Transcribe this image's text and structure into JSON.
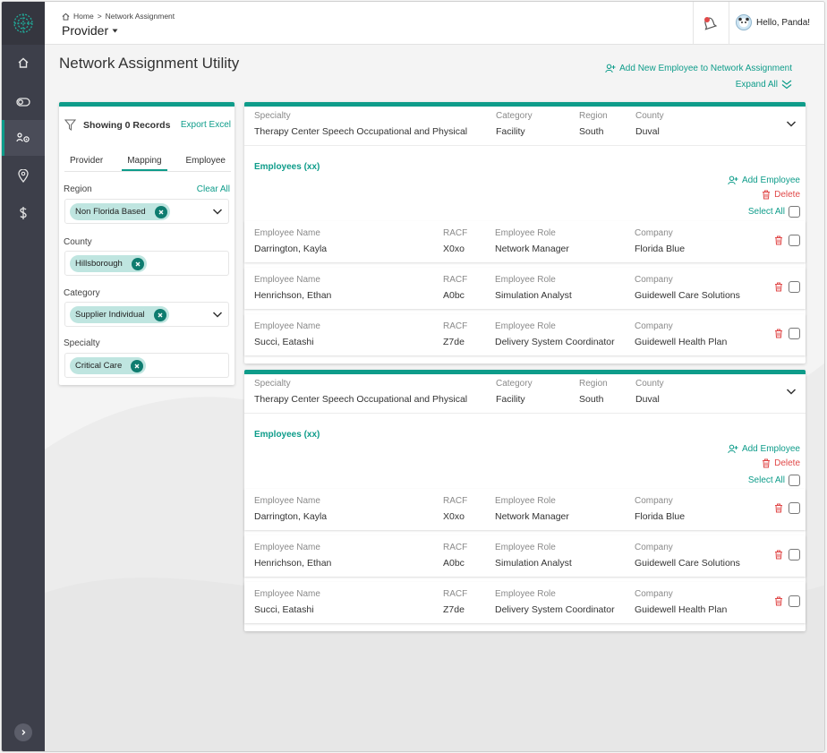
{
  "sidebar": {
    "logo": "globe-logo",
    "items": [
      {
        "icon": "home-icon"
      },
      {
        "icon": "toggle-icon"
      },
      {
        "icon": "network-assignment-icon",
        "active": true
      },
      {
        "icon": "location-pin-icon"
      },
      {
        "icon": "dollar-icon"
      }
    ],
    "expand_icon": "chevron-right-icon"
  },
  "header": {
    "breadcrumb": {
      "home": "Home",
      "separator": ">",
      "current": "Network Assignment"
    },
    "app_title": "Provider",
    "greeting": "Hello, Panda!"
  },
  "page": {
    "title": "Network Assignment Utility",
    "add_new_employee": "Add New Employee to Network Assignment",
    "expand_all": "Expand All"
  },
  "filter": {
    "showing": "Showing 0 Records",
    "export": "Export Excel",
    "tabs": [
      {
        "label": "Provider",
        "active": false
      },
      {
        "label": "Mapping",
        "active": true
      },
      {
        "label": "Employee",
        "active": false
      }
    ],
    "clear_all": "Clear All",
    "fields": [
      {
        "label": "Region",
        "chip": "Non Florida Based",
        "dropdown": true
      },
      {
        "label": "County",
        "chip": "Hillsborough",
        "dropdown": false
      },
      {
        "label": "Category",
        "chip": "Supplier Individual",
        "dropdown": true
      },
      {
        "label": "Specialty",
        "chip": "Critical Care",
        "dropdown": false
      }
    ]
  },
  "cards": [
    {
      "headers": {
        "specialty": "Specialty",
        "category": "Category",
        "region": "Region",
        "county": "County"
      },
      "values": {
        "specialty": "Therapy Center Speech Occupational and Physical",
        "category": "Facility",
        "region": "South",
        "county": "Duval"
      },
      "employees_title": "Employees (xx)",
      "add_employee": "Add Employee",
      "delete": "Delete",
      "select_all": "Select All",
      "row_labels": {
        "name": "Employee Name",
        "racf": "RACF",
        "role": "Employee Role",
        "company": "Company"
      },
      "rows": [
        {
          "name": "Darrington, Kayla",
          "racf": "X0xo",
          "role": "Network Manager",
          "company": "Florida Blue"
        },
        {
          "name": "Henrichson, Ethan",
          "racf": "A0bc",
          "role": "Simulation Analyst",
          "company": "Guidewell Care Solutions"
        },
        {
          "name": "Succi, Eatashi",
          "racf": "Z7de",
          "role": "Delivery System Coordinator",
          "company": "Guidewell Health Plan"
        }
      ]
    },
    {
      "headers": {
        "specialty": "Specialty",
        "category": "Category",
        "region": "Region",
        "county": "County"
      },
      "values": {
        "specialty": "Therapy Center Speech Occupational and Physical",
        "category": "Facility",
        "region": "South",
        "county": "Duval"
      },
      "employees_title": "Employees (xx)",
      "add_employee": "Add Employee",
      "delete": "Delete",
      "select_all": "Select All",
      "row_labels": {
        "name": "Employee Name",
        "racf": "RACF",
        "role": "Employee Role",
        "company": "Company"
      },
      "rows": [
        {
          "name": "Darrington, Kayla",
          "racf": "X0xo",
          "role": "Network Manager",
          "company": "Florida Blue"
        },
        {
          "name": "Henrichson, Ethan",
          "racf": "A0bc",
          "role": "Simulation Analyst",
          "company": "Guidewell Care Solutions"
        },
        {
          "name": "Succi, Eatashi",
          "racf": "Z7de",
          "role": "Delivery System Coordinator",
          "company": "Guidewell Health Plan"
        }
      ]
    }
  ],
  "colors": {
    "accent": "#0e9c8a",
    "sidebar": "#3d3f4a",
    "delete": "#e04848",
    "chip": "#bfe5e0"
  }
}
